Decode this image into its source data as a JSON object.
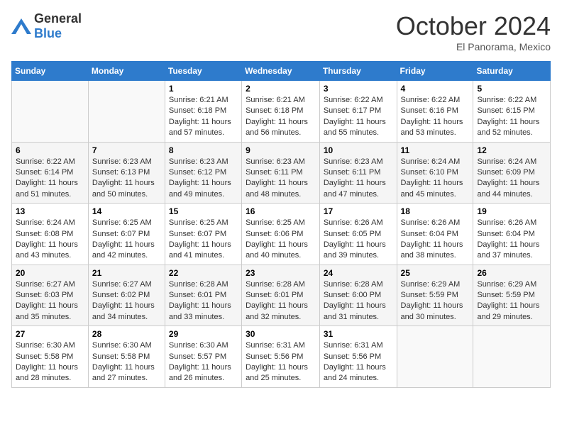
{
  "header": {
    "logo_general": "General",
    "logo_blue": "Blue",
    "month_title": "October 2024",
    "subtitle": "El Panorama, Mexico"
  },
  "weekdays": [
    "Sunday",
    "Monday",
    "Tuesday",
    "Wednesday",
    "Thursday",
    "Friday",
    "Saturday"
  ],
  "weeks": [
    [
      {
        "day": "",
        "sunrise": "",
        "sunset": "",
        "daylight": ""
      },
      {
        "day": "",
        "sunrise": "",
        "sunset": "",
        "daylight": ""
      },
      {
        "day": "1",
        "sunrise": "Sunrise: 6:21 AM",
        "sunset": "Sunset: 6:18 PM",
        "daylight": "Daylight: 11 hours and 57 minutes."
      },
      {
        "day": "2",
        "sunrise": "Sunrise: 6:21 AM",
        "sunset": "Sunset: 6:18 PM",
        "daylight": "Daylight: 11 hours and 56 minutes."
      },
      {
        "day": "3",
        "sunrise": "Sunrise: 6:22 AM",
        "sunset": "Sunset: 6:17 PM",
        "daylight": "Daylight: 11 hours and 55 minutes."
      },
      {
        "day": "4",
        "sunrise": "Sunrise: 6:22 AM",
        "sunset": "Sunset: 6:16 PM",
        "daylight": "Daylight: 11 hours and 53 minutes."
      },
      {
        "day": "5",
        "sunrise": "Sunrise: 6:22 AM",
        "sunset": "Sunset: 6:15 PM",
        "daylight": "Daylight: 11 hours and 52 minutes."
      }
    ],
    [
      {
        "day": "6",
        "sunrise": "Sunrise: 6:22 AM",
        "sunset": "Sunset: 6:14 PM",
        "daylight": "Daylight: 11 hours and 51 minutes."
      },
      {
        "day": "7",
        "sunrise": "Sunrise: 6:23 AM",
        "sunset": "Sunset: 6:13 PM",
        "daylight": "Daylight: 11 hours and 50 minutes."
      },
      {
        "day": "8",
        "sunrise": "Sunrise: 6:23 AM",
        "sunset": "Sunset: 6:12 PM",
        "daylight": "Daylight: 11 hours and 49 minutes."
      },
      {
        "day": "9",
        "sunrise": "Sunrise: 6:23 AM",
        "sunset": "Sunset: 6:11 PM",
        "daylight": "Daylight: 11 hours and 48 minutes."
      },
      {
        "day": "10",
        "sunrise": "Sunrise: 6:23 AM",
        "sunset": "Sunset: 6:11 PM",
        "daylight": "Daylight: 11 hours and 47 minutes."
      },
      {
        "day": "11",
        "sunrise": "Sunrise: 6:24 AM",
        "sunset": "Sunset: 6:10 PM",
        "daylight": "Daylight: 11 hours and 45 minutes."
      },
      {
        "day": "12",
        "sunrise": "Sunrise: 6:24 AM",
        "sunset": "Sunset: 6:09 PM",
        "daylight": "Daylight: 11 hours and 44 minutes."
      }
    ],
    [
      {
        "day": "13",
        "sunrise": "Sunrise: 6:24 AM",
        "sunset": "Sunset: 6:08 PM",
        "daylight": "Daylight: 11 hours and 43 minutes."
      },
      {
        "day": "14",
        "sunrise": "Sunrise: 6:25 AM",
        "sunset": "Sunset: 6:07 PM",
        "daylight": "Daylight: 11 hours and 42 minutes."
      },
      {
        "day": "15",
        "sunrise": "Sunrise: 6:25 AM",
        "sunset": "Sunset: 6:07 PM",
        "daylight": "Daylight: 11 hours and 41 minutes."
      },
      {
        "day": "16",
        "sunrise": "Sunrise: 6:25 AM",
        "sunset": "Sunset: 6:06 PM",
        "daylight": "Daylight: 11 hours and 40 minutes."
      },
      {
        "day": "17",
        "sunrise": "Sunrise: 6:26 AM",
        "sunset": "Sunset: 6:05 PM",
        "daylight": "Daylight: 11 hours and 39 minutes."
      },
      {
        "day": "18",
        "sunrise": "Sunrise: 6:26 AM",
        "sunset": "Sunset: 6:04 PM",
        "daylight": "Daylight: 11 hours and 38 minutes."
      },
      {
        "day": "19",
        "sunrise": "Sunrise: 6:26 AM",
        "sunset": "Sunset: 6:04 PM",
        "daylight": "Daylight: 11 hours and 37 minutes."
      }
    ],
    [
      {
        "day": "20",
        "sunrise": "Sunrise: 6:27 AM",
        "sunset": "Sunset: 6:03 PM",
        "daylight": "Daylight: 11 hours and 35 minutes."
      },
      {
        "day": "21",
        "sunrise": "Sunrise: 6:27 AM",
        "sunset": "Sunset: 6:02 PM",
        "daylight": "Daylight: 11 hours and 34 minutes."
      },
      {
        "day": "22",
        "sunrise": "Sunrise: 6:28 AM",
        "sunset": "Sunset: 6:01 PM",
        "daylight": "Daylight: 11 hours and 33 minutes."
      },
      {
        "day": "23",
        "sunrise": "Sunrise: 6:28 AM",
        "sunset": "Sunset: 6:01 PM",
        "daylight": "Daylight: 11 hours and 32 minutes."
      },
      {
        "day": "24",
        "sunrise": "Sunrise: 6:28 AM",
        "sunset": "Sunset: 6:00 PM",
        "daylight": "Daylight: 11 hours and 31 minutes."
      },
      {
        "day": "25",
        "sunrise": "Sunrise: 6:29 AM",
        "sunset": "Sunset: 5:59 PM",
        "daylight": "Daylight: 11 hours and 30 minutes."
      },
      {
        "day": "26",
        "sunrise": "Sunrise: 6:29 AM",
        "sunset": "Sunset: 5:59 PM",
        "daylight": "Daylight: 11 hours and 29 minutes."
      }
    ],
    [
      {
        "day": "27",
        "sunrise": "Sunrise: 6:30 AM",
        "sunset": "Sunset: 5:58 PM",
        "daylight": "Daylight: 11 hours and 28 minutes."
      },
      {
        "day": "28",
        "sunrise": "Sunrise: 6:30 AM",
        "sunset": "Sunset: 5:58 PM",
        "daylight": "Daylight: 11 hours and 27 minutes."
      },
      {
        "day": "29",
        "sunrise": "Sunrise: 6:30 AM",
        "sunset": "Sunset: 5:57 PM",
        "daylight": "Daylight: 11 hours and 26 minutes."
      },
      {
        "day": "30",
        "sunrise": "Sunrise: 6:31 AM",
        "sunset": "Sunset: 5:56 PM",
        "daylight": "Daylight: 11 hours and 25 minutes."
      },
      {
        "day": "31",
        "sunrise": "Sunrise: 6:31 AM",
        "sunset": "Sunset: 5:56 PM",
        "daylight": "Daylight: 11 hours and 24 minutes."
      },
      {
        "day": "",
        "sunrise": "",
        "sunset": "",
        "daylight": ""
      },
      {
        "day": "",
        "sunrise": "",
        "sunset": "",
        "daylight": ""
      }
    ]
  ]
}
